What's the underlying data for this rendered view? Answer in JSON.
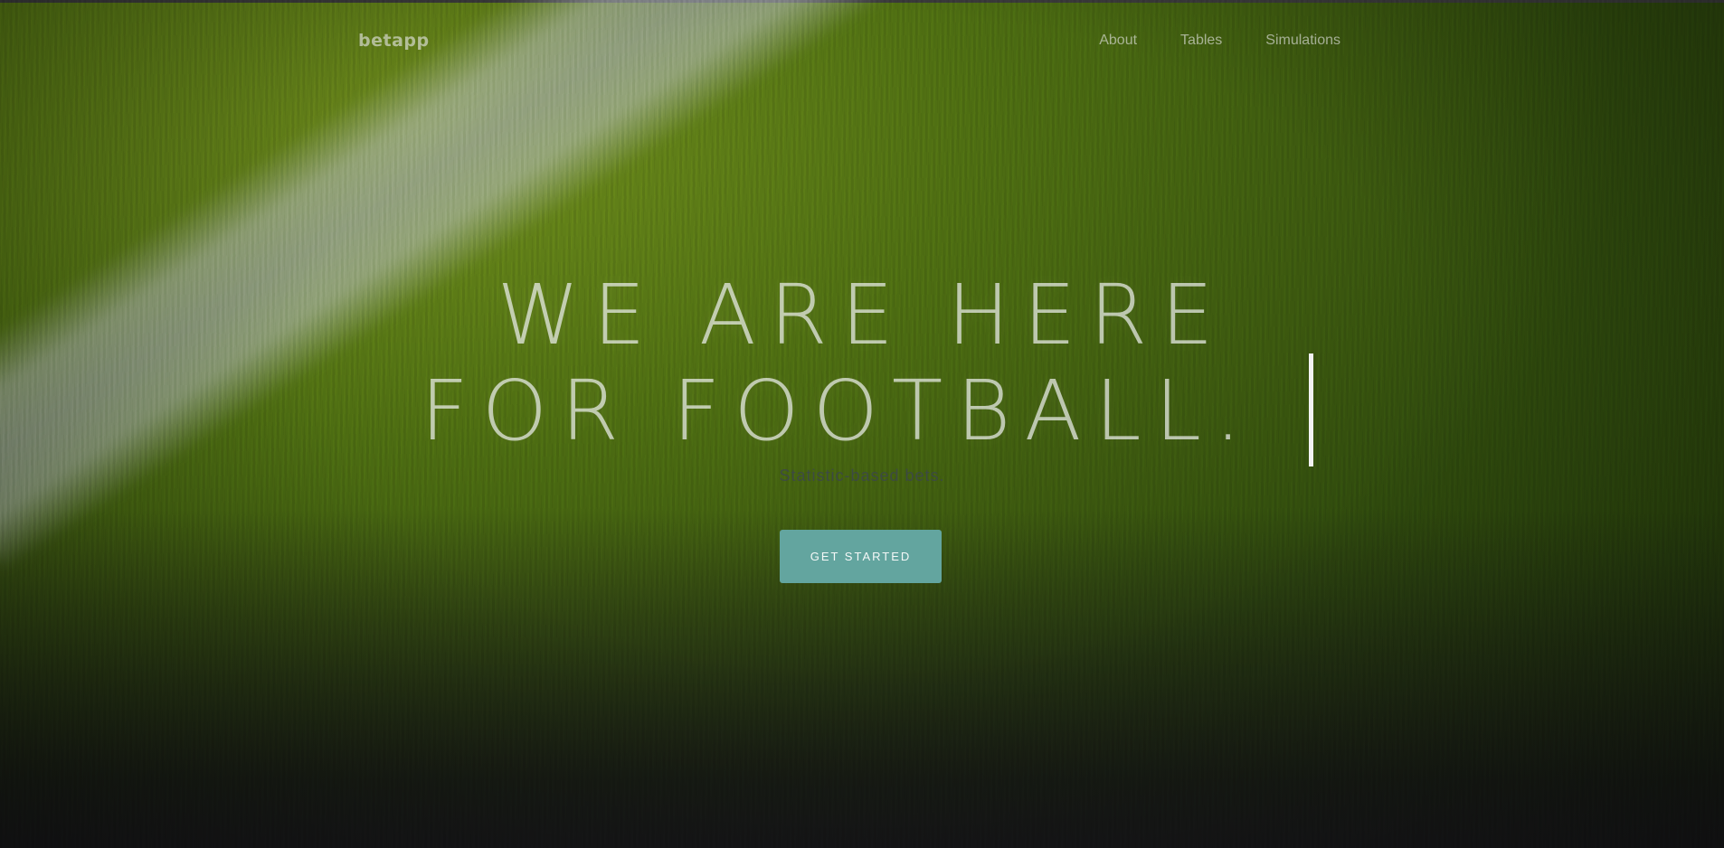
{
  "nav": {
    "brand": "betapp",
    "links": [
      {
        "label": "About"
      },
      {
        "label": "Tables"
      },
      {
        "label": "Simulations"
      }
    ]
  },
  "hero": {
    "headline_line1": "WE ARE HERE",
    "headline_line2": "FOR FOOTBALL.",
    "subtitle": "Statistic-based bets.",
    "cta_label": "GET STARTED"
  },
  "colors": {
    "accent": "#63a59f",
    "grass": "#4e6e12",
    "field_line": "#b8bcc2"
  },
  "icons": {
    "typing_caret": "typing-caret-icon"
  }
}
